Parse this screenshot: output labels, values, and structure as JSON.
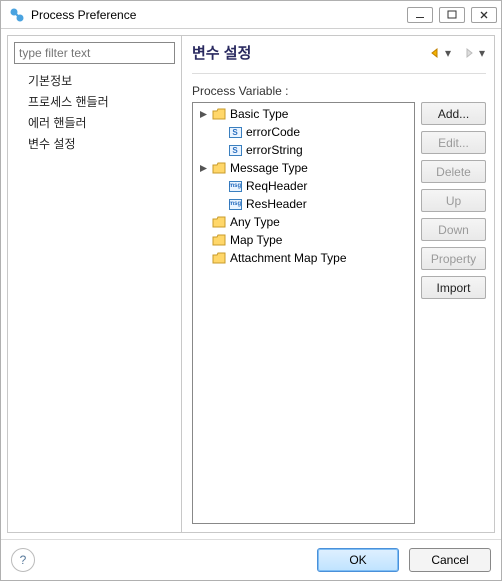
{
  "window": {
    "title": "Process Preference"
  },
  "filter": {
    "placeholder": "type filter text"
  },
  "nav": {
    "items": [
      "기본정보",
      "프로세스 핸들러",
      "에러 핸들러",
      "변수 설정"
    ],
    "selected_index": 3
  },
  "panel": {
    "heading": "변수 설정",
    "variable_label": "Process Variable :"
  },
  "tree": {
    "basic": {
      "label": "Basic Type",
      "children": [
        "errorCode",
        "errorString"
      ]
    },
    "message": {
      "label": "Message Type",
      "children": [
        "ReqHeader",
        "ResHeader"
      ]
    },
    "any": {
      "label": "Any Type"
    },
    "map": {
      "label": "Map Type"
    },
    "attach": {
      "label": "Attachment Map Type"
    }
  },
  "buttons": {
    "add": "Add...",
    "edit": "Edit...",
    "delete": "Delete",
    "up": "Up",
    "down": "Down",
    "property": "Property",
    "import": "Import"
  },
  "footer": {
    "ok": "OK",
    "cancel": "Cancel"
  },
  "iconletters": {
    "s": "S",
    "msg": "msg"
  }
}
